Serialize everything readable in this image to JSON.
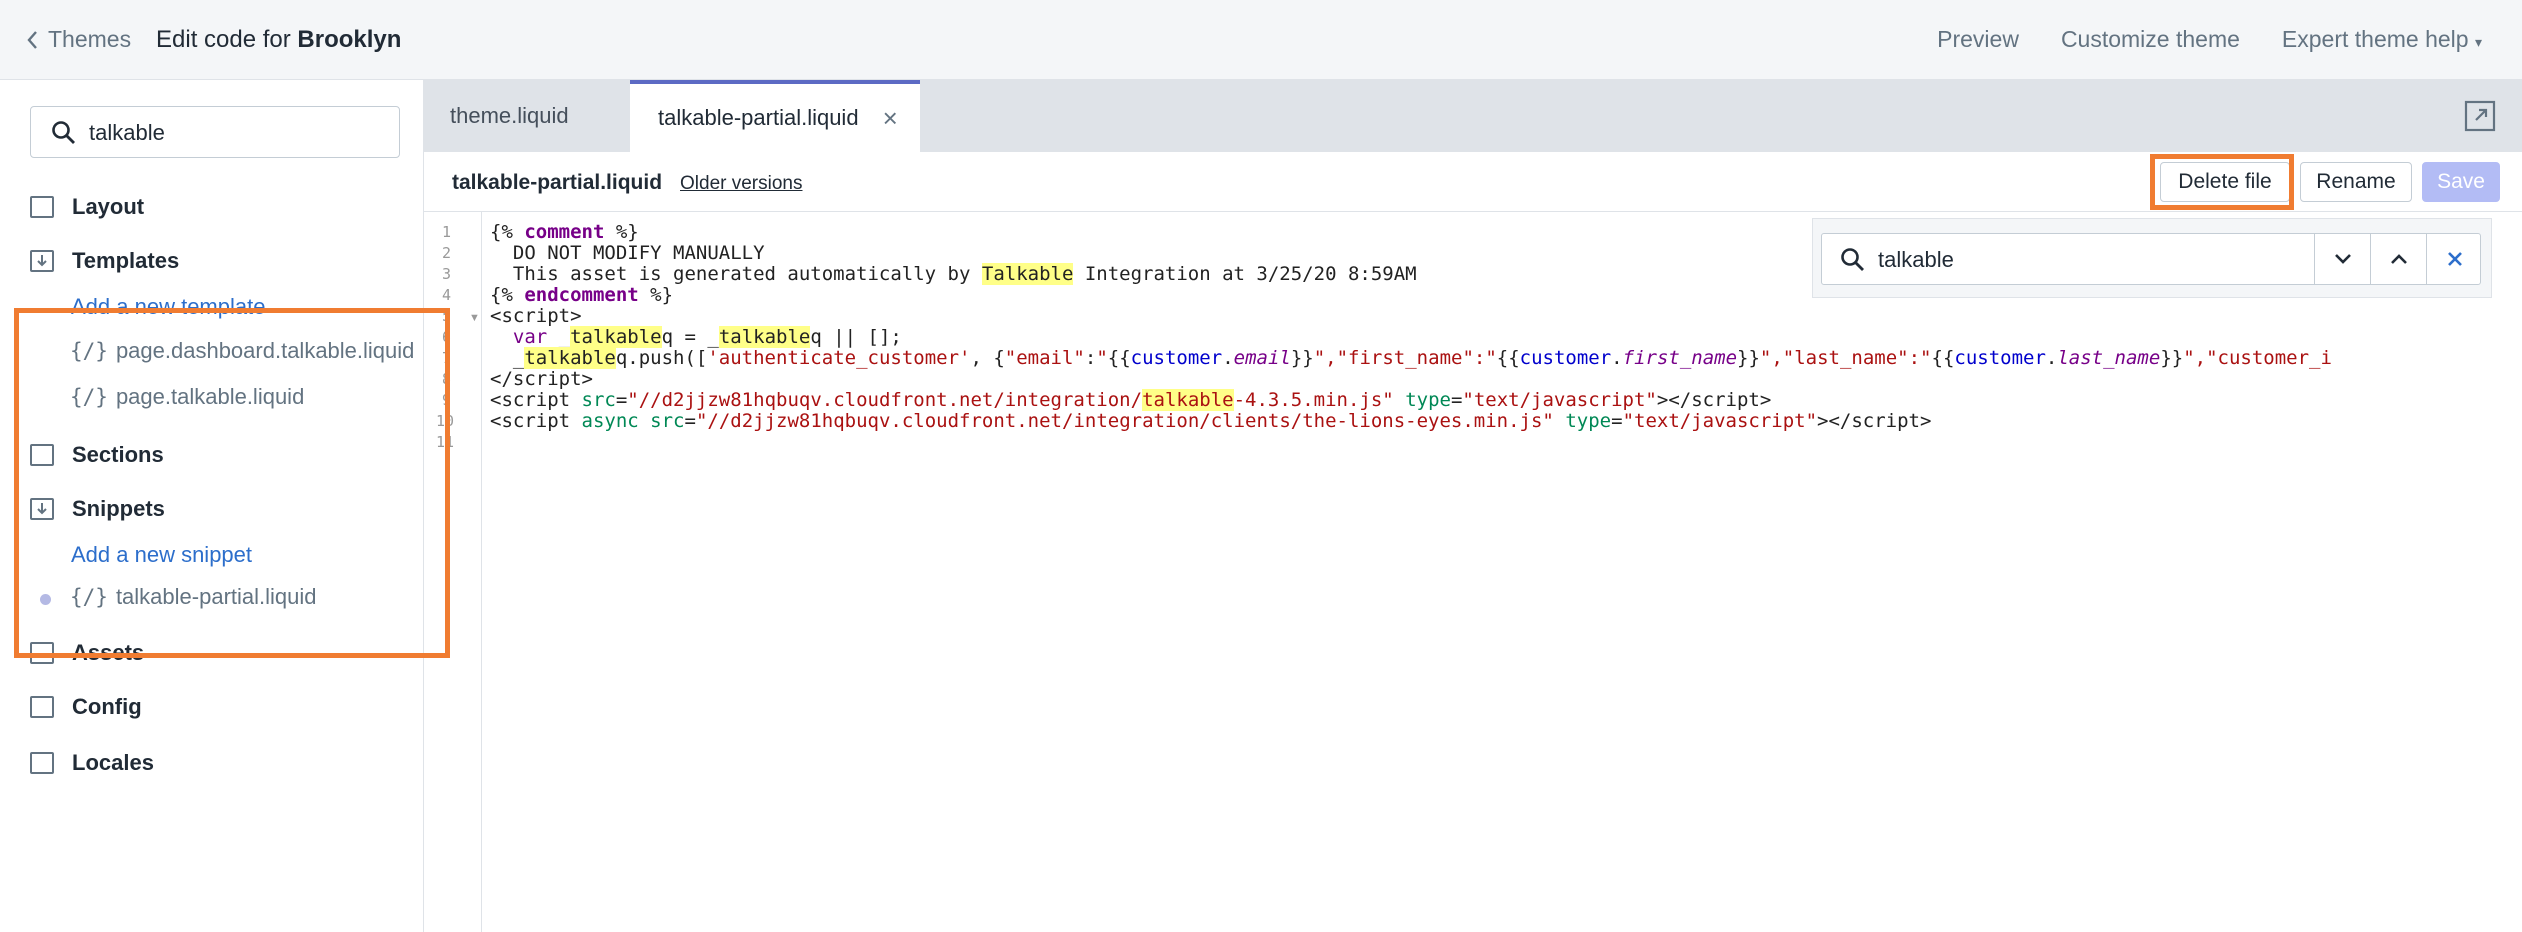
{
  "topbar": {
    "back_label": "Themes",
    "title_prefix": "Edit code for ",
    "theme_name": "Brooklyn",
    "nav": {
      "preview": "Preview",
      "customize": "Customize theme",
      "help": "Expert theme help"
    }
  },
  "sidebar": {
    "search_value": "talkable",
    "folders": {
      "layout": "Layout",
      "templates": "Templates",
      "sections": "Sections",
      "snippets": "Snippets",
      "assets": "Assets",
      "config": "Config",
      "locales": "Locales"
    },
    "add_template": "Add a new template",
    "template_files": [
      "page.dashboard.talkable.liquid",
      "page.talkable.liquid"
    ],
    "add_snippet": "Add a new snippet",
    "snippet_files": [
      "talkable-partial.liquid"
    ],
    "file_glyph": "{/}"
  },
  "tabs": [
    {
      "label": "theme.liquid"
    },
    {
      "label": "talkable-partial.liquid",
      "close": "×"
    }
  ],
  "filebar": {
    "file_name": "talkable-partial.liquid",
    "older_versions": "Older versions",
    "delete": "Delete file",
    "rename": "Rename",
    "save": "Save"
  },
  "find": {
    "value": "talkable"
  },
  "editor": {
    "line_numbers": [
      "1",
      "2",
      "3",
      "4",
      "5",
      "6",
      "7",
      "8",
      "9",
      "10",
      "11"
    ]
  },
  "colors": {
    "accent": "#5c6ac4",
    "highlight": "#f07c31",
    "link": "#2c6ecb"
  }
}
